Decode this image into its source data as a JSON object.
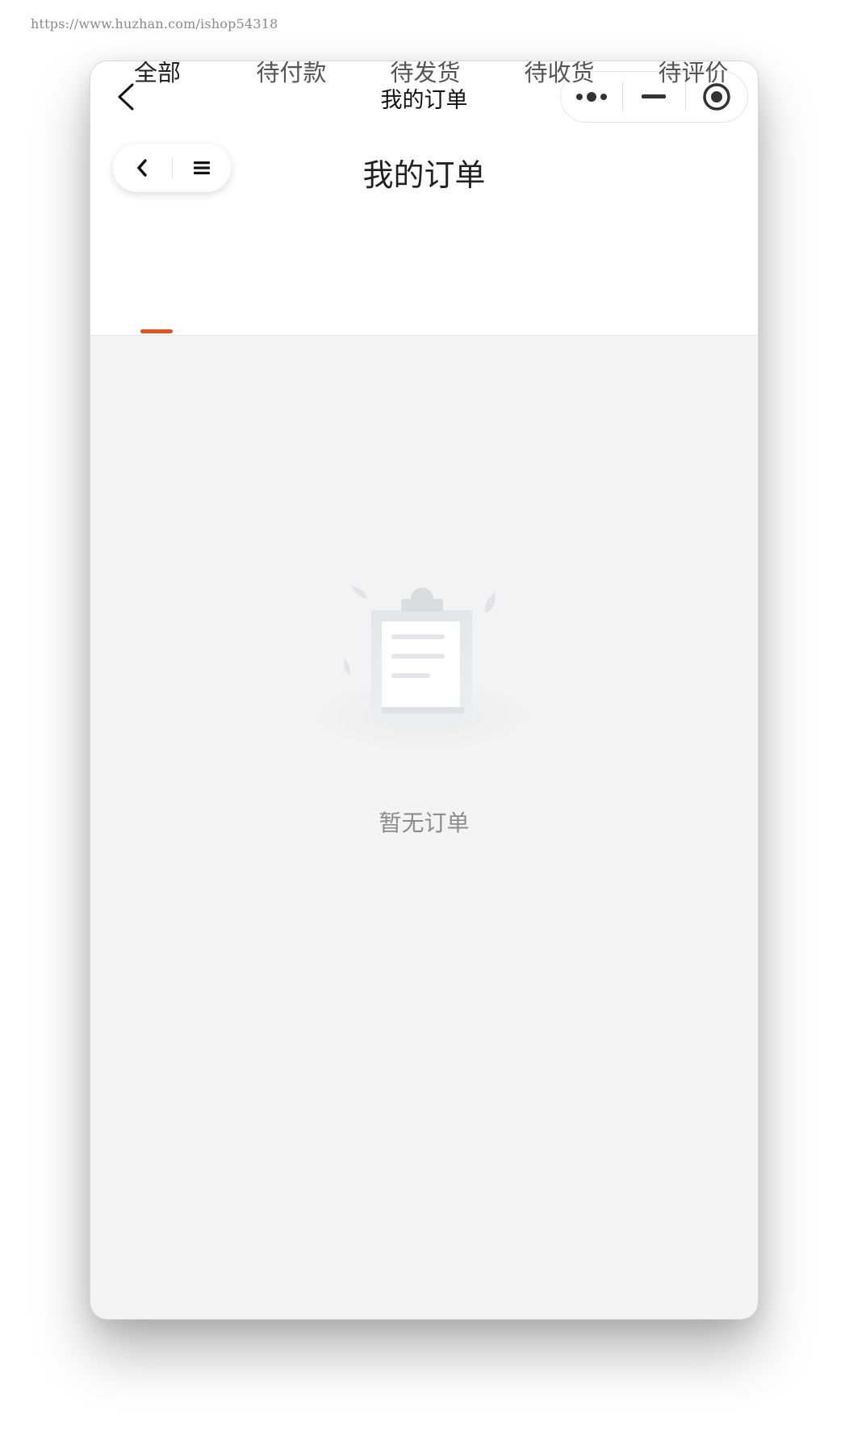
{
  "watermark": "https://www.huzhan.com/ishop54318",
  "titlebar": {
    "title": "我的订单",
    "back_icon": "chevron-left-icon",
    "capsule": {
      "more_icon": "more-dots-icon",
      "minimize_icon": "minimize-icon",
      "close_icon": "target-circle-icon"
    }
  },
  "navbar": {
    "title": "我的订单",
    "back_icon": "chevron-left-icon",
    "menu_icon": "menu-icon"
  },
  "tabs": [
    {
      "label": "全部",
      "active": true
    },
    {
      "label": "待付款",
      "active": false
    },
    {
      "label": "待发货",
      "active": false
    },
    {
      "label": "待收货",
      "active": false
    },
    {
      "label": "待评价",
      "active": false
    }
  ],
  "empty_state": {
    "icon": "clipboard-icon",
    "text": "暂无订单"
  },
  "colors": {
    "accent": "#e4531b",
    "background": "#f3f3f3",
    "text_primary": "#222222",
    "text_secondary": "#8c8c8c"
  }
}
